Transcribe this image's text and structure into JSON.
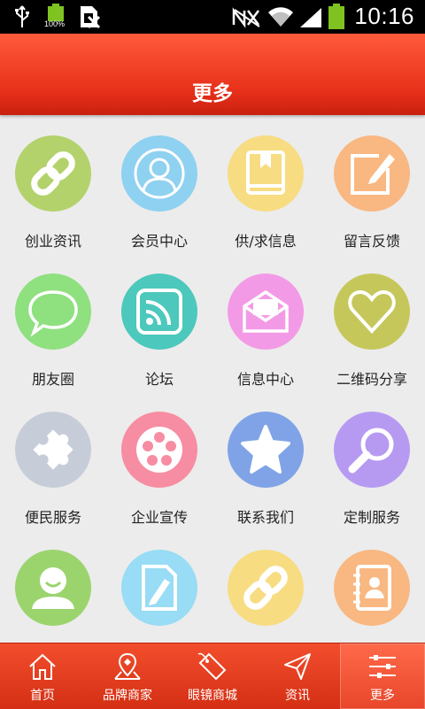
{
  "status_bar": {
    "time": "10:16",
    "battery_percent": "100%",
    "icons": [
      "usb-icon",
      "battery-full-icon",
      "sim-blocked-icon",
      "nfc-off-icon",
      "wifi-icon",
      "signal-icon",
      "battery-icon"
    ]
  },
  "header": {
    "title": "更多"
  },
  "grid": {
    "items": [
      {
        "label": "创业资讯",
        "icon": "link-icon",
        "color": "#b3d26c"
      },
      {
        "label": "会员中心",
        "icon": "user-icon",
        "color": "#8fd1f0"
      },
      {
        "label": "供/求信息",
        "icon": "book-icon",
        "color": "#f7dc82"
      },
      {
        "label": "留言反馈",
        "icon": "edit-icon",
        "color": "#f9b781"
      },
      {
        "label": "朋友圈",
        "icon": "chat-bubble-icon",
        "color": "#8fe07f"
      },
      {
        "label": "论坛",
        "icon": "rss-icon",
        "color": "#4cc8bc"
      },
      {
        "label": "信息中心",
        "icon": "mail-icon",
        "color": "#f39ae6"
      },
      {
        "label": "二维码分享",
        "icon": "heart-icon",
        "color": "#c6c75a"
      },
      {
        "label": "便民服务",
        "icon": "puzzle-icon",
        "color": "#c7cdd8"
      },
      {
        "label": "企业宣传",
        "icon": "film-reel-icon",
        "color": "#f78da2"
      },
      {
        "label": "联系我们",
        "icon": "star-icon",
        "color": "#7fa3e6"
      },
      {
        "label": "定制服务",
        "icon": "magnifier-icon",
        "color": "#b69af2"
      },
      {
        "label": "",
        "icon": "smiley-user-icon",
        "color": "#9bd46d"
      },
      {
        "label": "",
        "icon": "document-pencil-icon",
        "color": "#98dcf5"
      },
      {
        "label": "",
        "icon": "link-icon",
        "color": "#f7dc82"
      },
      {
        "label": "",
        "icon": "address-book-icon",
        "color": "#f9b781"
      }
    ]
  },
  "tabbar": {
    "active_index": 4,
    "tabs": [
      {
        "label": "首页",
        "icon": "home-icon"
      },
      {
        "label": "品牌商家",
        "icon": "map-pin-icon"
      },
      {
        "label": "眼镜商城",
        "icon": "sale-tag-icon"
      },
      {
        "label": "资讯",
        "icon": "send-icon"
      },
      {
        "label": "更多",
        "icon": "sliders-icon"
      }
    ]
  },
  "colors": {
    "header_gradient_top": "#ff5a3c",
    "header_gradient_bottom": "#c9200f",
    "tabbar": "#e23c1e",
    "background": "#ececec"
  }
}
